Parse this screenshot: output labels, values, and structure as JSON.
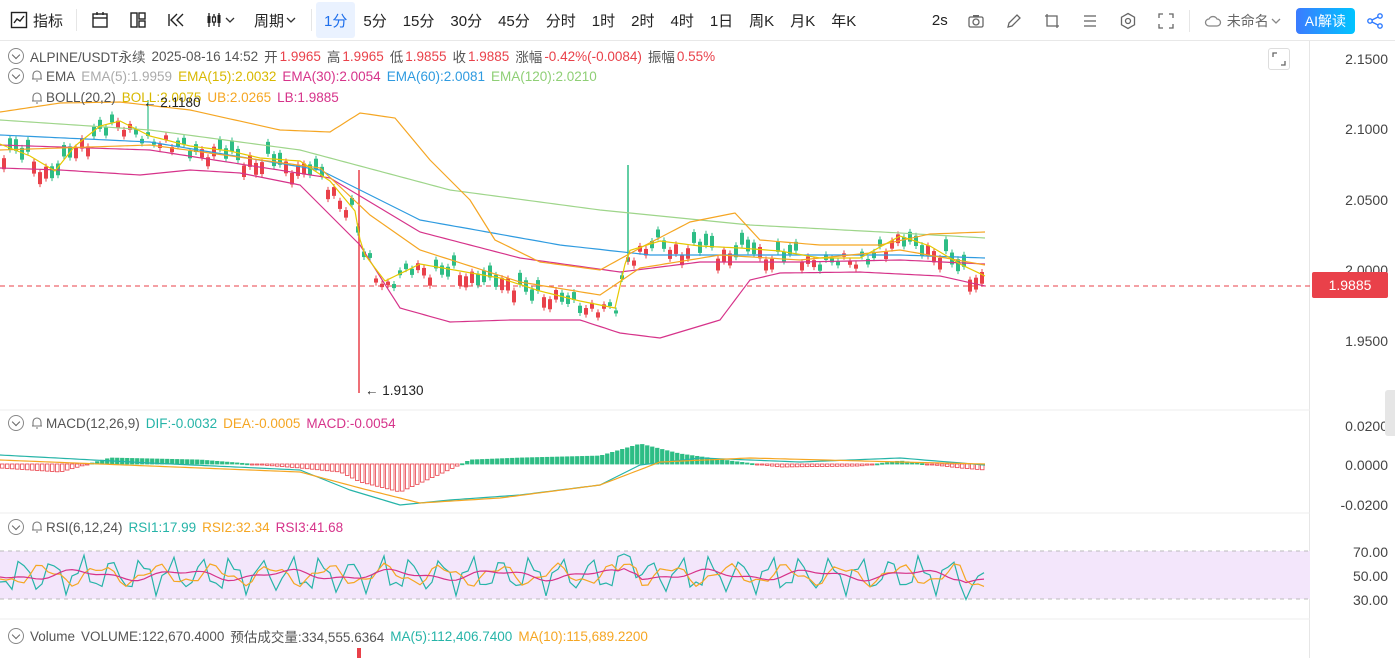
{
  "toolbar": {
    "indicators_label": "指标",
    "period_label": "周期",
    "intervals": [
      "1分",
      "5分",
      "15分",
      "30分",
      "45分",
      "分时",
      "1时",
      "2时",
      "4时",
      "1日",
      "周K",
      "月K",
      "年K"
    ],
    "active_interval": "1分",
    "refresh_label": "2s",
    "layout_name": "未命名",
    "ai_label": "AI解读"
  },
  "header": {
    "symbol": "ALPINE/USDT永续",
    "datetime": "2025-08-16 14:52",
    "open_label": "开",
    "open": "1.9965",
    "high_label": "高",
    "high": "1.9965",
    "low_label": "低",
    "low": "1.9855",
    "close_label": "收",
    "close": "1.9885",
    "change_label": "涨幅",
    "change": "-0.42%(-0.0084)",
    "amp_label": "振幅",
    "amp": "0.55%"
  },
  "ema": {
    "name": "EMA",
    "ema5": "EMA(5):1.9959",
    "ema15": "EMA(15):2.0032",
    "ema30": "EMA(30):2.0054",
    "ema60": "EMA(60):2.0081",
    "ema120": "EMA(120):2.0210"
  },
  "boll": {
    "name": "BOLL(20,2)",
    "mid": "BOLL:2.0075",
    "ub": "UB:2.0265",
    "lb": "LB:1.9885"
  },
  "macd": {
    "name": "MACD(12,26,9)",
    "dif": "DIF:-0.0032",
    "dea": "DEA:-0.0005",
    "macd": "MACD:-0.0054"
  },
  "rsi": {
    "name": "RSI(6,12,24)",
    "rsi1": "RSI1:17.99",
    "rsi2": "RSI2:32.34",
    "rsi3": "RSI3:41.68"
  },
  "volume": {
    "name": "Volume",
    "volume": "VOLUME:122,670.4000",
    "estimate": "预估成交量:334,555.6364",
    "ma5": "MA(5):112,406.7400",
    "ma10": "MA(10):115,689.2200"
  },
  "annotations": {
    "high_mark": "2.1180",
    "low_mark": "1.9130"
  },
  "price_axis": [
    "2.1500",
    "2.1000",
    "2.0500",
    "2.0000",
    "1.9500"
  ],
  "current_price": "1.9885",
  "macd_axis": [
    "0.0200",
    "0.0000",
    "-0.0200"
  ],
  "rsi_axis": [
    "70.00",
    "50.00",
    "30.00"
  ],
  "colors": {
    "up": "#2ebd85",
    "down": "#e9414a",
    "ema5": "#e6c800",
    "ema15": "#f5a623",
    "ema30": "#d6338a",
    "ema60": "#2f9be0",
    "ema120": "#9ed58a",
    "boll_mid": "#e6c800",
    "boll_ub": "#f5a623",
    "boll_lb": "#d6338a",
    "dif": "#26b4a8",
    "dea": "#f5a623",
    "rsi1": "#26b4a8",
    "rsi2": "#f5a623",
    "rsi3": "#d6338a"
  },
  "icons": [
    "indicators-icon",
    "calendar-icon",
    "layout-icon",
    "replay-icon",
    "chart-type-icon",
    "camera-icon",
    "pencil-icon",
    "crop-icon",
    "list-icon",
    "settings-icon",
    "fullscreen-icon",
    "cloud-icon",
    "share-icon",
    "bell-icon"
  ]
}
